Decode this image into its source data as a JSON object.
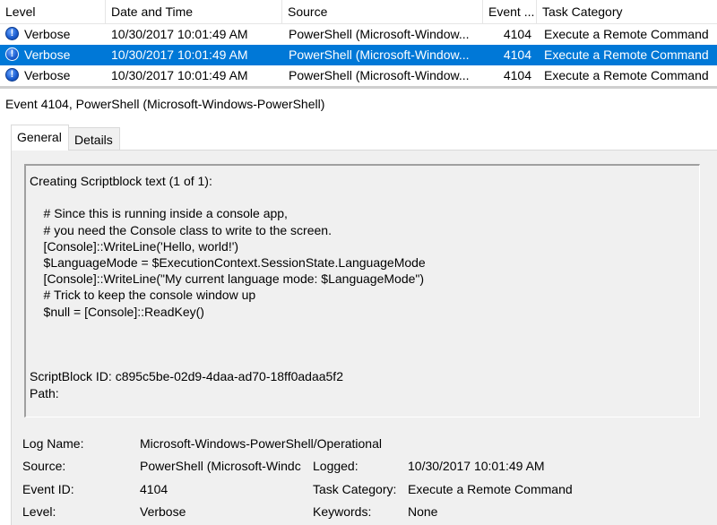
{
  "grid": {
    "columns": [
      "Level",
      "Date and Time",
      "Source",
      "Event ...",
      "Task Category"
    ],
    "rows": [
      {
        "level": "Verbose",
        "date": "10/30/2017 10:01:49 AM",
        "source": "PowerShell (Microsoft-Window...",
        "event": "4104",
        "task": "Execute a Remote Command",
        "selected": false
      },
      {
        "level": "Verbose",
        "date": "10/30/2017 10:01:49 AM",
        "source": "PowerShell (Microsoft-Window...",
        "event": "4104",
        "task": "Execute a Remote Command",
        "selected": true
      },
      {
        "level": "Verbose",
        "date": "10/30/2017 10:01:49 AM",
        "source": "PowerShell (Microsoft-Window...",
        "event": "4104",
        "task": "Execute a Remote Command",
        "selected": false
      }
    ],
    "level_icon": "information-icon",
    "selected_color": "#0078d7"
  },
  "detail": {
    "title": "Event 4104, PowerShell (Microsoft-Windows-PowerShell)",
    "tabs": {
      "general": "General",
      "details": "Details"
    },
    "description": "Creating Scriptblock text (1 of 1):\n\n    # Since this is running inside a console app,\n    # you need the Console class to write to the screen.\n    [Console]::WriteLine('Hello, world!')\n    $LanguageMode = $ExecutionContext.SessionState.LanguageMode\n    [Console]::WriteLine(\"My current language mode: $LanguageMode\")\n    # Trick to keep the console window up\n    $null = [Console]::ReadKey()\n\n\n\nScriptBlock ID: c895c5be-02d9-4daa-ad70-18ff0adaa5f2\nPath:",
    "properties": {
      "log_name_label": "Log Name:",
      "log_name_value": "Microsoft-Windows-PowerShell/Operational",
      "source_label": "Source:",
      "source_value": "PowerShell (Microsoft-Windc",
      "logged_label": "Logged:",
      "logged_value": "10/30/2017 10:01:49 AM",
      "event_id_label": "Event ID:",
      "event_id_value": "4104",
      "task_category_label": "Task Category:",
      "task_category_value": "Execute a Remote Command",
      "level_label": "Level:",
      "level_value": "Verbose",
      "keywords_label": "Keywords:",
      "keywords_value": "None"
    }
  }
}
